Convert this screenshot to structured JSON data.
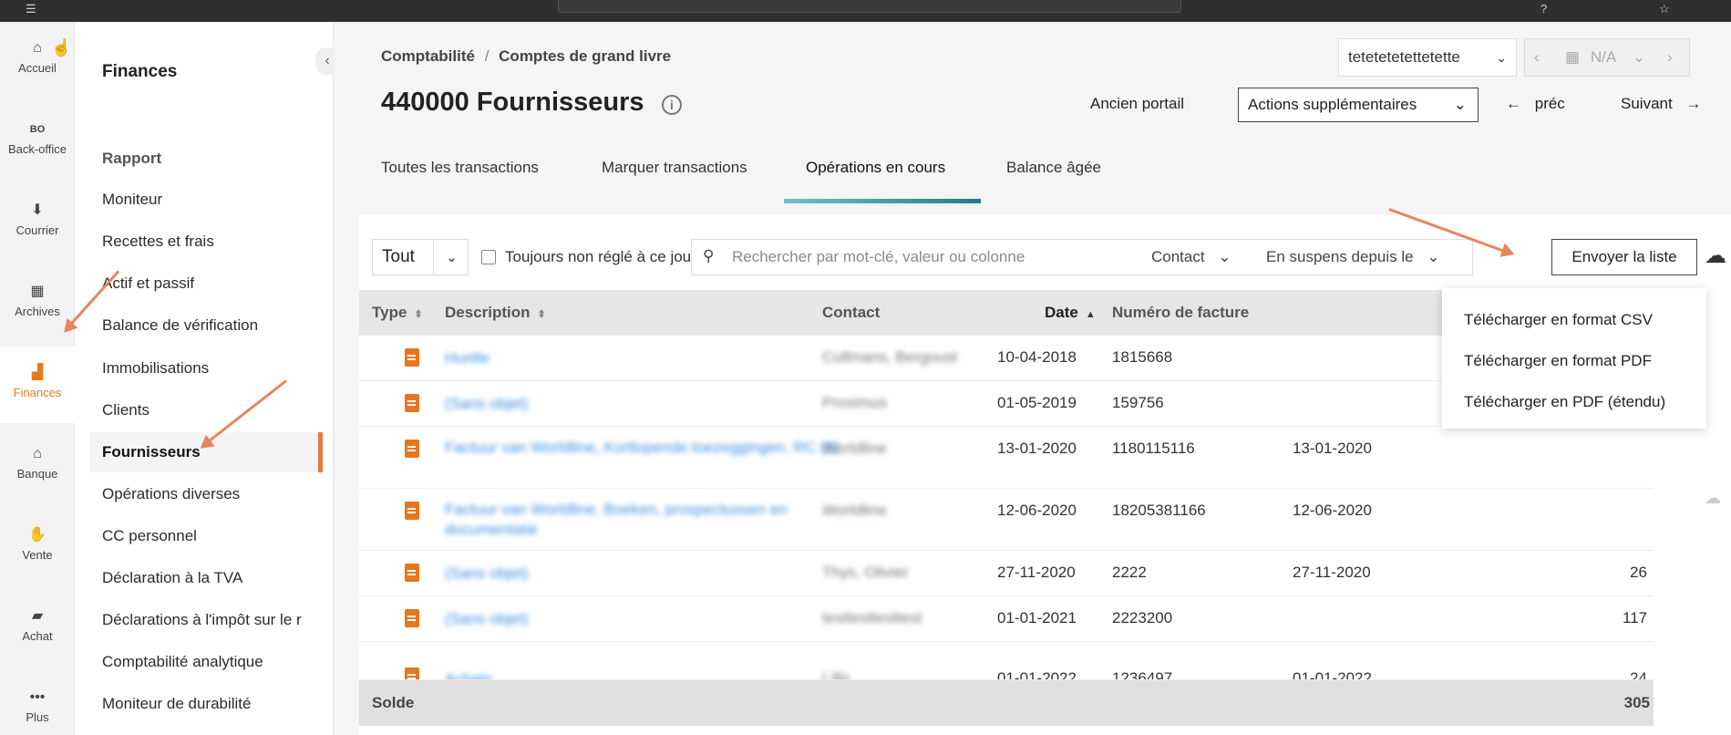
{
  "rail": [
    {
      "label": "Accueil",
      "icon": "home-icon"
    },
    {
      "label": "Back-office",
      "icon": "bo-icon"
    },
    {
      "label": "Courrier",
      "icon": "inbox-icon"
    },
    {
      "label": "Archives",
      "icon": "archive-icon"
    },
    {
      "label": "Finances",
      "icon": "bar-chart-icon"
    },
    {
      "label": "Banque",
      "icon": "bank-icon"
    },
    {
      "label": "Vente",
      "icon": "handshake-icon"
    },
    {
      "label": "Achat",
      "icon": "truck-icon"
    },
    {
      "label": "Plus",
      "icon": "more-icon"
    }
  ],
  "subnav": {
    "title": "Finances",
    "section": "Rapport",
    "items": [
      "Moniteur",
      "Recettes et frais",
      "Actif et passif",
      "Balance de vérification",
      "Immobilisations",
      "Clients",
      "Fournisseurs",
      "Opérations diverses",
      "CC personnel",
      "Déclaration à la TVA",
      "Déclarations à l'impôt sur le r",
      "Comptabilité analytique",
      "Moniteur de durabilité"
    ],
    "active_index": 6
  },
  "header": {
    "breadcrumb_1": "Comptabilité",
    "breadcrumb_sep": "/",
    "breadcrumb_2": "Comptes de grand livre",
    "title": "440000 Fournisseurs",
    "company": "tetetetetettetette",
    "period": "N/A",
    "old_portal": "Ancien portail",
    "more_actions": "Actions supplémentaires",
    "prev": "préc",
    "next": "Suivant"
  },
  "tabs": [
    "Toutes les transactions",
    "Marquer transactions",
    "Opérations en cours",
    "Balance âgée"
  ],
  "active_tab": 2,
  "filters": {
    "status_value": "Tout",
    "checkbox_label": "Toujours non réglé à ce jour",
    "search_placeholder": "Rechercher par mot-clé, valeur ou colonne",
    "contact_filter": "Contact",
    "pending_filter": "En suspens depuis le",
    "send_list": "Envoyer la liste"
  },
  "table": {
    "columns": [
      "Type",
      "Description",
      "Contact",
      "Date",
      "Numéro de facture"
    ],
    "rows": [
      {
        "description": "Huntle",
        "contact": "Cullmans, Bergoust",
        "date": "10-04-2018",
        "invoice": "1815668",
        "due": "",
        "amount": ""
      },
      {
        "description": "(Sans objet)",
        "contact": "Proximus",
        "date": "01-05-2019",
        "invoice": "159756",
        "due": "",
        "amount": ""
      },
      {
        "description": "Factuur van Worldline, Kortlopende toezeggingen, RC (8)",
        "contact": "Worldline",
        "date": "13-01-2020",
        "invoice": "1180115116",
        "due": "13-01-2020",
        "amount": ""
      },
      {
        "description": "Factuur van Worldline, Boeken, prospectussen en documentatie",
        "contact": "Worldline",
        "date": "12-06-2020",
        "invoice": "18205381166",
        "due": "12-06-2020",
        "amount": ""
      },
      {
        "description": "(Sans objet)",
        "contact": "Thys, Olivier",
        "date": "27-11-2020",
        "invoice": "2222",
        "due": "27-11-2020",
        "amount": "26"
      },
      {
        "description": "(Sans objet)",
        "contact": "testtesttesttest",
        "date": "01-01-2021",
        "invoice": "2223200",
        "due": "",
        "amount": "117"
      },
      {
        "description": "Achats",
        "contact": "Lillo",
        "date": "01-01-2022",
        "invoice": "1236497",
        "due": "01-01-2022",
        "amount": "24"
      }
    ],
    "total_label": "Solde",
    "total_value": "305"
  },
  "download_menu": [
    "Télécharger en format CSV",
    "Télécharger en format PDF",
    "Télécharger en PDF (étendu)"
  ],
  "colors": {
    "accent": "#e87a1e",
    "tab_underline": "#1f7d8c",
    "annotation": "#e8845f"
  }
}
